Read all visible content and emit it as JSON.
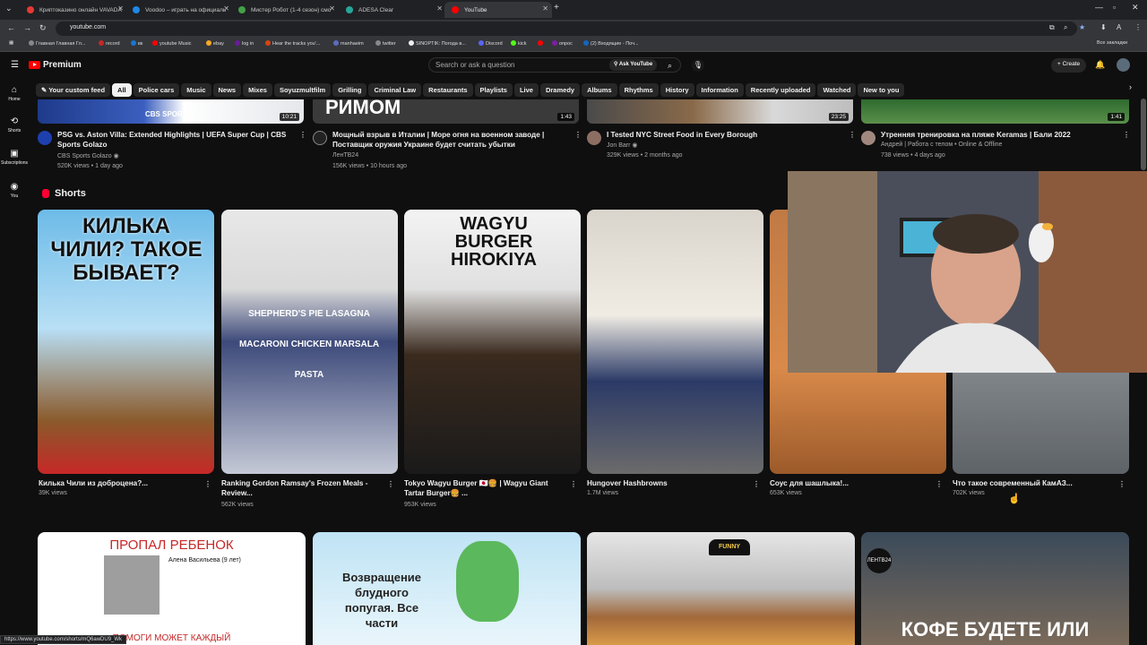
{
  "tabs": [
    {
      "title": "Криптоказино онлайн VAVADA",
      "color": "#e53935"
    },
    {
      "title": "Voodoo – играть на официаль",
      "color": "#1e88e5"
    },
    {
      "title": "Мистер Робот (1-4 сезон) смо",
      "color": "#43a047"
    },
    {
      "title": "ADESA Clear",
      "color": "#26a69a"
    },
    {
      "title": "YouTube",
      "color": "#ff0000"
    }
  ],
  "address": {
    "url": "youtube.com"
  },
  "bookmarks": [
    {
      "label": "Главная Главная Гл...",
      "color": "#888"
    },
    {
      "label": "record",
      "color": "#c62828"
    },
    {
      "label": "вк",
      "color": "#1976d2"
    },
    {
      "label": "youtube Music",
      "color": "#ff0000"
    },
    {
      "label": "ebay",
      "color": "#f9a825"
    },
    {
      "label": "log in",
      "color": "#6a1b9a"
    },
    {
      "label": "Hear the tracks you'...",
      "color": "#d84315"
    },
    {
      "label": "manhaeim",
      "color": "#5c6bc0"
    },
    {
      "label": "twitter",
      "color": "#888"
    },
    {
      "label": "SINOPTIK: Погода в...",
      "color": "#eee"
    },
    {
      "label": "Discord",
      "color": "#5865f2"
    },
    {
      "label": "kick",
      "color": "#53fc18"
    },
    {
      "label": "",
      "color": "#ff0000"
    },
    {
      "label": "опрос",
      "color": "#7b1fa2"
    },
    {
      "label": "(2) Входящие - Поч...",
      "color": "#1565c0"
    }
  ],
  "bookmarks_all": "Все закладки",
  "header": {
    "brand": "Premium",
    "search_placeholder": "Search or ask a question",
    "ask_label": "Ask YouTube",
    "create_label": "Create"
  },
  "rail": [
    {
      "label": "Home",
      "icon": "home-icon"
    },
    {
      "label": "Shorts",
      "icon": "shorts-icon"
    },
    {
      "label": "Subscriptions",
      "icon": "subscriptions-icon"
    },
    {
      "label": "You",
      "icon": "you-icon"
    }
  ],
  "chips": [
    "Your custom feed",
    "All",
    "Police cars",
    "Music",
    "News",
    "Mixes",
    "Soyuzmultfilm",
    "Grilling",
    "Criminal Law",
    "Restaurants",
    "Playlists",
    "Live",
    "Dramedy",
    "Albums",
    "Rhythms",
    "History",
    "Information",
    "Recently uploaded",
    "Watched",
    "New to you"
  ],
  "videos": [
    {
      "duration": "10:21",
      "title1": "PSG vs. Aston Villa: Extended Highlights | UEFA Super Cup | CBS",
      "title2": "Sports Golazo",
      "channel": "CBS Sports Golazo",
      "meta": "520K views • 1 day ago",
      "thumb_text": "CBS SPORTS"
    },
    {
      "duration": "1:43",
      "title1": "Мощный взрыв в Италии | Море огня на военном заводе |",
      "title2": "Поставщик оружия Украине будет считать убытки",
      "channel": "ЛенТВ24",
      "meta": "156K views • 10 hours ago",
      "thumb_text": "РИМОМ"
    },
    {
      "duration": "23:25",
      "title1": "I Tested NYC Street Food in Every Borough",
      "title2": "",
      "channel": "Jon Barr",
      "meta": "329K views • 2 months ago",
      "thumb_text": ""
    },
    {
      "duration": "1:41",
      "title1": "Утренняя тренировка на пляже Keramas | Бали 2022",
      "title2": "",
      "channel": "Андрей | Работа с телом • Online & Offline",
      "meta": "738 views • 4 days ago",
      "thumb_text": ""
    }
  ],
  "shorts_heading": "Shorts",
  "shorts": [
    {
      "title1": "Килька Чили из доброцена?...",
      "title2": "",
      "views": "39K views",
      "overlay": "КИЛЬКА ЧИЛИ? ТАКОЕ БЫВАЕТ?"
    },
    {
      "title1": "Ranking Gordon Ramsay's Frozen Meals -",
      "title2": "Review...",
      "views": "562K views",
      "overlay": "SHEPHERD'S PIE LASAGNA MACARONI CHICKEN MARSALA PASTA"
    },
    {
      "title1": "Tokyo Wagyu Burger 🇯🇵🍔 | Wagyu Giant",
      "title2": "Tartar Burger🍔 ...",
      "views": "953K views",
      "overlay": "WAGYU BURGER HIROKIYA"
    },
    {
      "title1": "Hungover Hashbrowns",
      "title2": "",
      "views": "1.7M views",
      "overlay": ""
    },
    {
      "title1": "Соус для шашлыка!...",
      "title2": "",
      "views": "653K views",
      "overlay": ""
    },
    {
      "title1": "Что такое современный КамАЗ...",
      "title2": "",
      "views": "702K views",
      "overlay": ""
    }
  ],
  "bottom": [
    {
      "headline": "ПРОПАЛ РЕБЕНОК",
      "sub": "Алена Васильева (9 лет)",
      "footer": "ПОМОГИ МОЖЕТ КАЖДЫЙ"
    },
    {
      "headline": "Возвращение блудного попугая. Все части",
      "sub": "",
      "footer": ""
    },
    {
      "headline": "FUNNY",
      "sub": "",
      "footer": ""
    },
    {
      "headline": "КОФЕ БУДЕТЕ ИЛИ",
      "sub": "ЛЕНТВ24",
      "footer": ""
    }
  ],
  "status_url": "https://www.youtube.com/shorts/mQ6awDU9_Wk"
}
